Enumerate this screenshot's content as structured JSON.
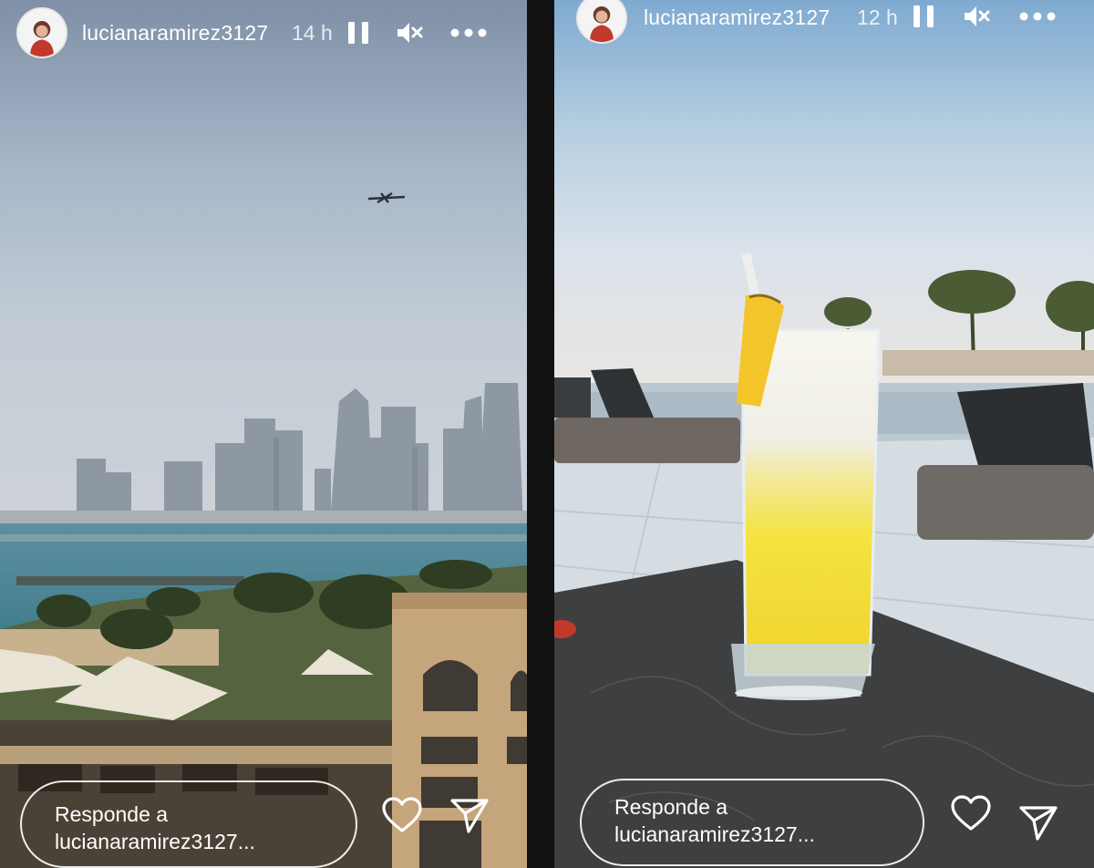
{
  "stories": [
    {
      "username": "lucianaramirez3127",
      "time": "14 h",
      "reply_prefix": "Responde a",
      "reply_user": "lucianaramirez3127..."
    },
    {
      "username": "lucianaramirez3127",
      "time": "12 h",
      "reply_prefix": "Responde a",
      "reply_user": "lucianaramirez3127..."
    }
  ],
  "icons": {
    "pause": "pause-icon",
    "mute": "muted-speaker-icon",
    "more": "more-options-icon",
    "like": "heart-icon",
    "share": "send-icon"
  },
  "colors": {
    "overlay_text": "#ffffff",
    "avatar_red": "#c0392b"
  }
}
